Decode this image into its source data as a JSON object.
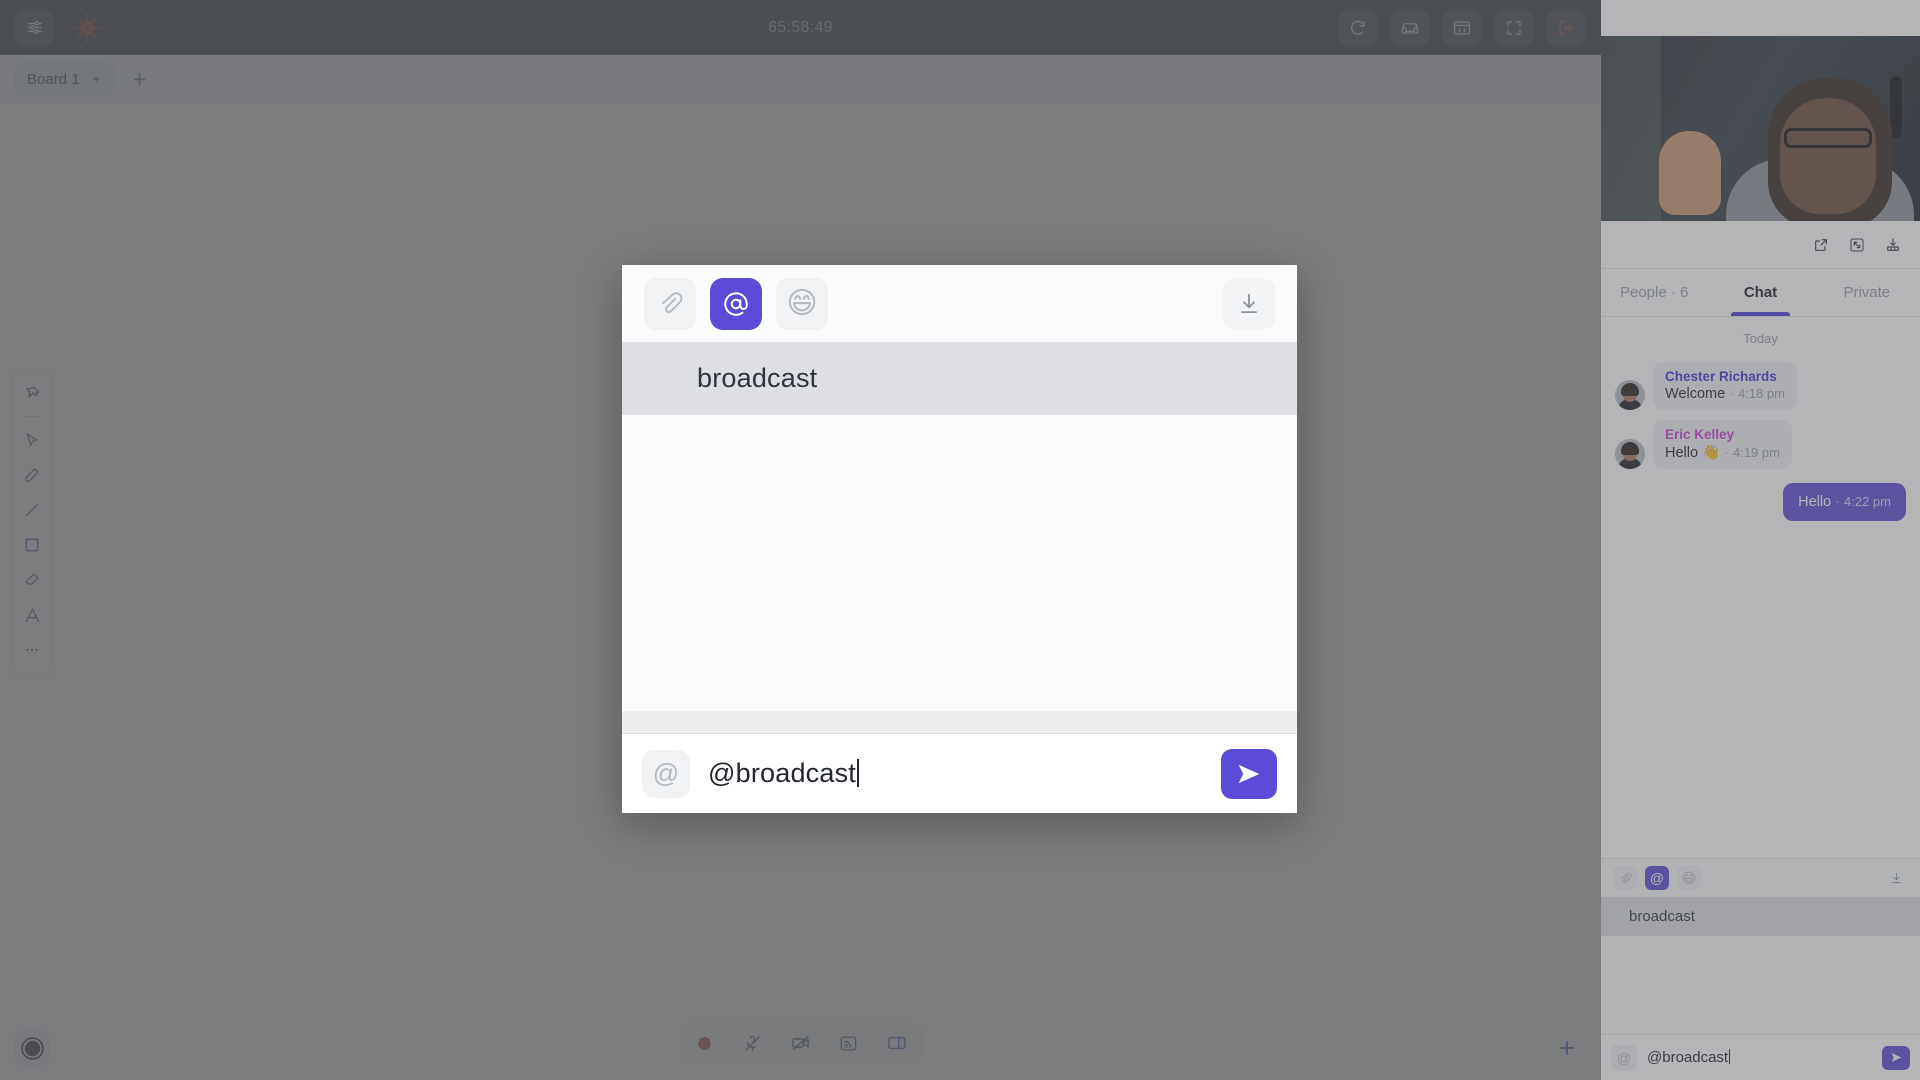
{
  "topbar": {
    "settings_icon": "sliders-icon",
    "brand_icon": "snowflake-logo",
    "timer": "65:58:49",
    "right_buttons": [
      {
        "name": "redo-button",
        "icon": "redo-icon"
      },
      {
        "name": "lounge-button",
        "icon": "sofa-icon"
      },
      {
        "name": "embed-button",
        "icon": "code-window-icon"
      },
      {
        "name": "fullscreen-button",
        "icon": "fullscreen-icon"
      },
      {
        "name": "leave-button",
        "icon": "exit-icon",
        "color": "#c0392b"
      }
    ]
  },
  "boardbar": {
    "tab_label": "Board 1",
    "chevron": "chevron-down-icon",
    "add_label": "+"
  },
  "tools": [
    {
      "name": "pin-tool",
      "icon": "pushpin-icon",
      "active": false
    },
    {
      "name": "select-tool",
      "icon": "cursor-icon",
      "active": false
    },
    {
      "name": "pencil-tool",
      "icon": "pencil-icon",
      "active": false
    },
    {
      "name": "line-tool",
      "icon": "line-icon",
      "active": false
    },
    {
      "name": "rectangle-tool",
      "icon": "square-icon",
      "active": true
    },
    {
      "name": "eraser-tool",
      "icon": "eraser-icon",
      "active": false
    },
    {
      "name": "text-tool",
      "icon": "text-a-icon",
      "active": false
    },
    {
      "name": "more-tools",
      "icon": "ellipsis-icon",
      "active": false
    }
  ],
  "bottom": {
    "color_swatch": "black-color-circle",
    "dock": [
      {
        "name": "record-button",
        "icon": "record-circle-icon",
        "color": "#b8312a"
      },
      {
        "name": "microphone-button",
        "icon": "mic-muted-icon"
      },
      {
        "name": "camera-button",
        "icon": "camera-off-icon"
      },
      {
        "name": "screenshare-button",
        "icon": "cast-icon"
      },
      {
        "name": "sidepanel-toggle",
        "icon": "panel-right-icon",
        "active": true
      }
    ],
    "add_label": "+"
  },
  "panel": {
    "actions": [
      {
        "name": "popout-button",
        "icon": "external-link-icon"
      },
      {
        "name": "collapse-button",
        "icon": "minimize-arrows-icon"
      },
      {
        "name": "dock-button",
        "icon": "dock-down-icon"
      }
    ],
    "tabs": [
      {
        "label": "People · 6",
        "name": "tab-people",
        "active": false
      },
      {
        "label": "Chat",
        "name": "tab-chat",
        "active": true
      },
      {
        "label": "Private",
        "name": "tab-private",
        "active": false
      }
    ],
    "day_separator": "Today",
    "messages": [
      {
        "author": "Chester Richards",
        "author_color": "#3d3ad8",
        "text": "Welcome",
        "time": "4:18 pm",
        "own": false
      },
      {
        "author": "Eric Kelley",
        "author_color": "#c93fd6",
        "text": "Hello 👋",
        "time": "4:19 pm",
        "own": false
      },
      {
        "author": "",
        "author_color": "",
        "text": "Hello",
        "time": "4:22 pm",
        "own": true
      }
    ],
    "separator_dot": "·"
  },
  "composer": {
    "attach_icon": "paperclip-icon",
    "mention_icon": "at-icon",
    "emoji_icon": "😄",
    "download_icon": "download-icon",
    "suggestion": "broadcast",
    "at_prefix": "@",
    "input_value": "@broadcast",
    "send_icon": "send-paper-plane-icon"
  },
  "colors": {
    "accent": "#5b4bd6",
    "topbar_bg": "#111823",
    "record_red": "#b8312a",
    "brand_red": "#8e1f16",
    "suggestion_bg": "#dddfe2"
  }
}
